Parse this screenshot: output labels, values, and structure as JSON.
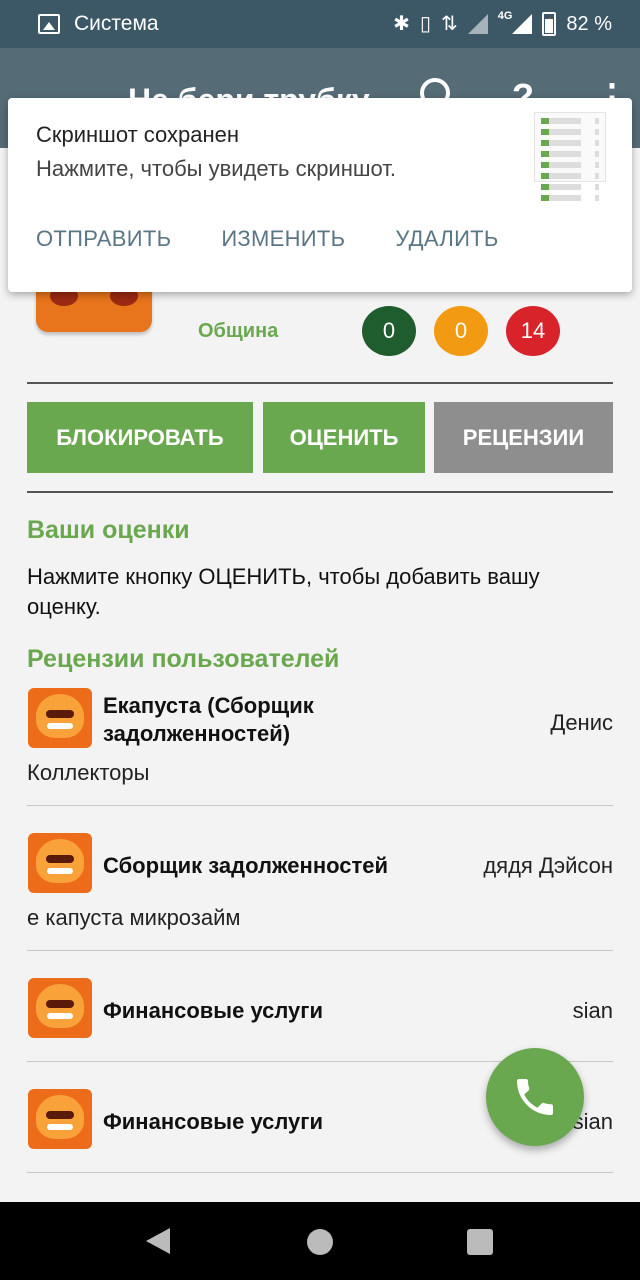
{
  "status_bar": {
    "app_name": "Система",
    "network": "4G",
    "battery": "82 %"
  },
  "app_bar": {
    "title": "Не бери трубку"
  },
  "notification": {
    "title": "Скриншот сохранен",
    "text": "Нажмите, чтобы увидеть скриншот.",
    "actions": [
      "ОТПРАВИТЬ",
      "ИЗМЕНИТЬ",
      "УДАЛИТЬ"
    ]
  },
  "header": {
    "category": "Община",
    "counters": [
      "0",
      "0",
      "14"
    ],
    "colors": {
      "green": "#1f5c2e",
      "orange": "#f29a12",
      "red": "#d8232a"
    }
  },
  "buttons": {
    "block": "БЛОКИРОВАТЬ",
    "rate": "ОЦЕНИТЬ",
    "reviews": "РЕЦЕНЗИИ"
  },
  "your_ratings": {
    "title": "Ваши оценки",
    "hint": "Нажмите кнопку ОЦЕНИТЬ, чтобы добавить вашу оценку."
  },
  "user_reviews": {
    "title": "Рецензии пользователей",
    "items": [
      {
        "title": "Екапуста (Сборщик задолженностей)",
        "author": "Денис",
        "text": "Коллекторы"
      },
      {
        "title": "Сборщик задолженностей",
        "author": "дядя Дэйсон",
        "text": "е капуста микрозайм"
      },
      {
        "title": "Финансовые услуги",
        "author": "sian",
        "text": ""
      },
      {
        "title": "Финансовые услуги",
        "author": "sian",
        "text": ""
      }
    ]
  },
  "accent_color": "#6aa84f"
}
